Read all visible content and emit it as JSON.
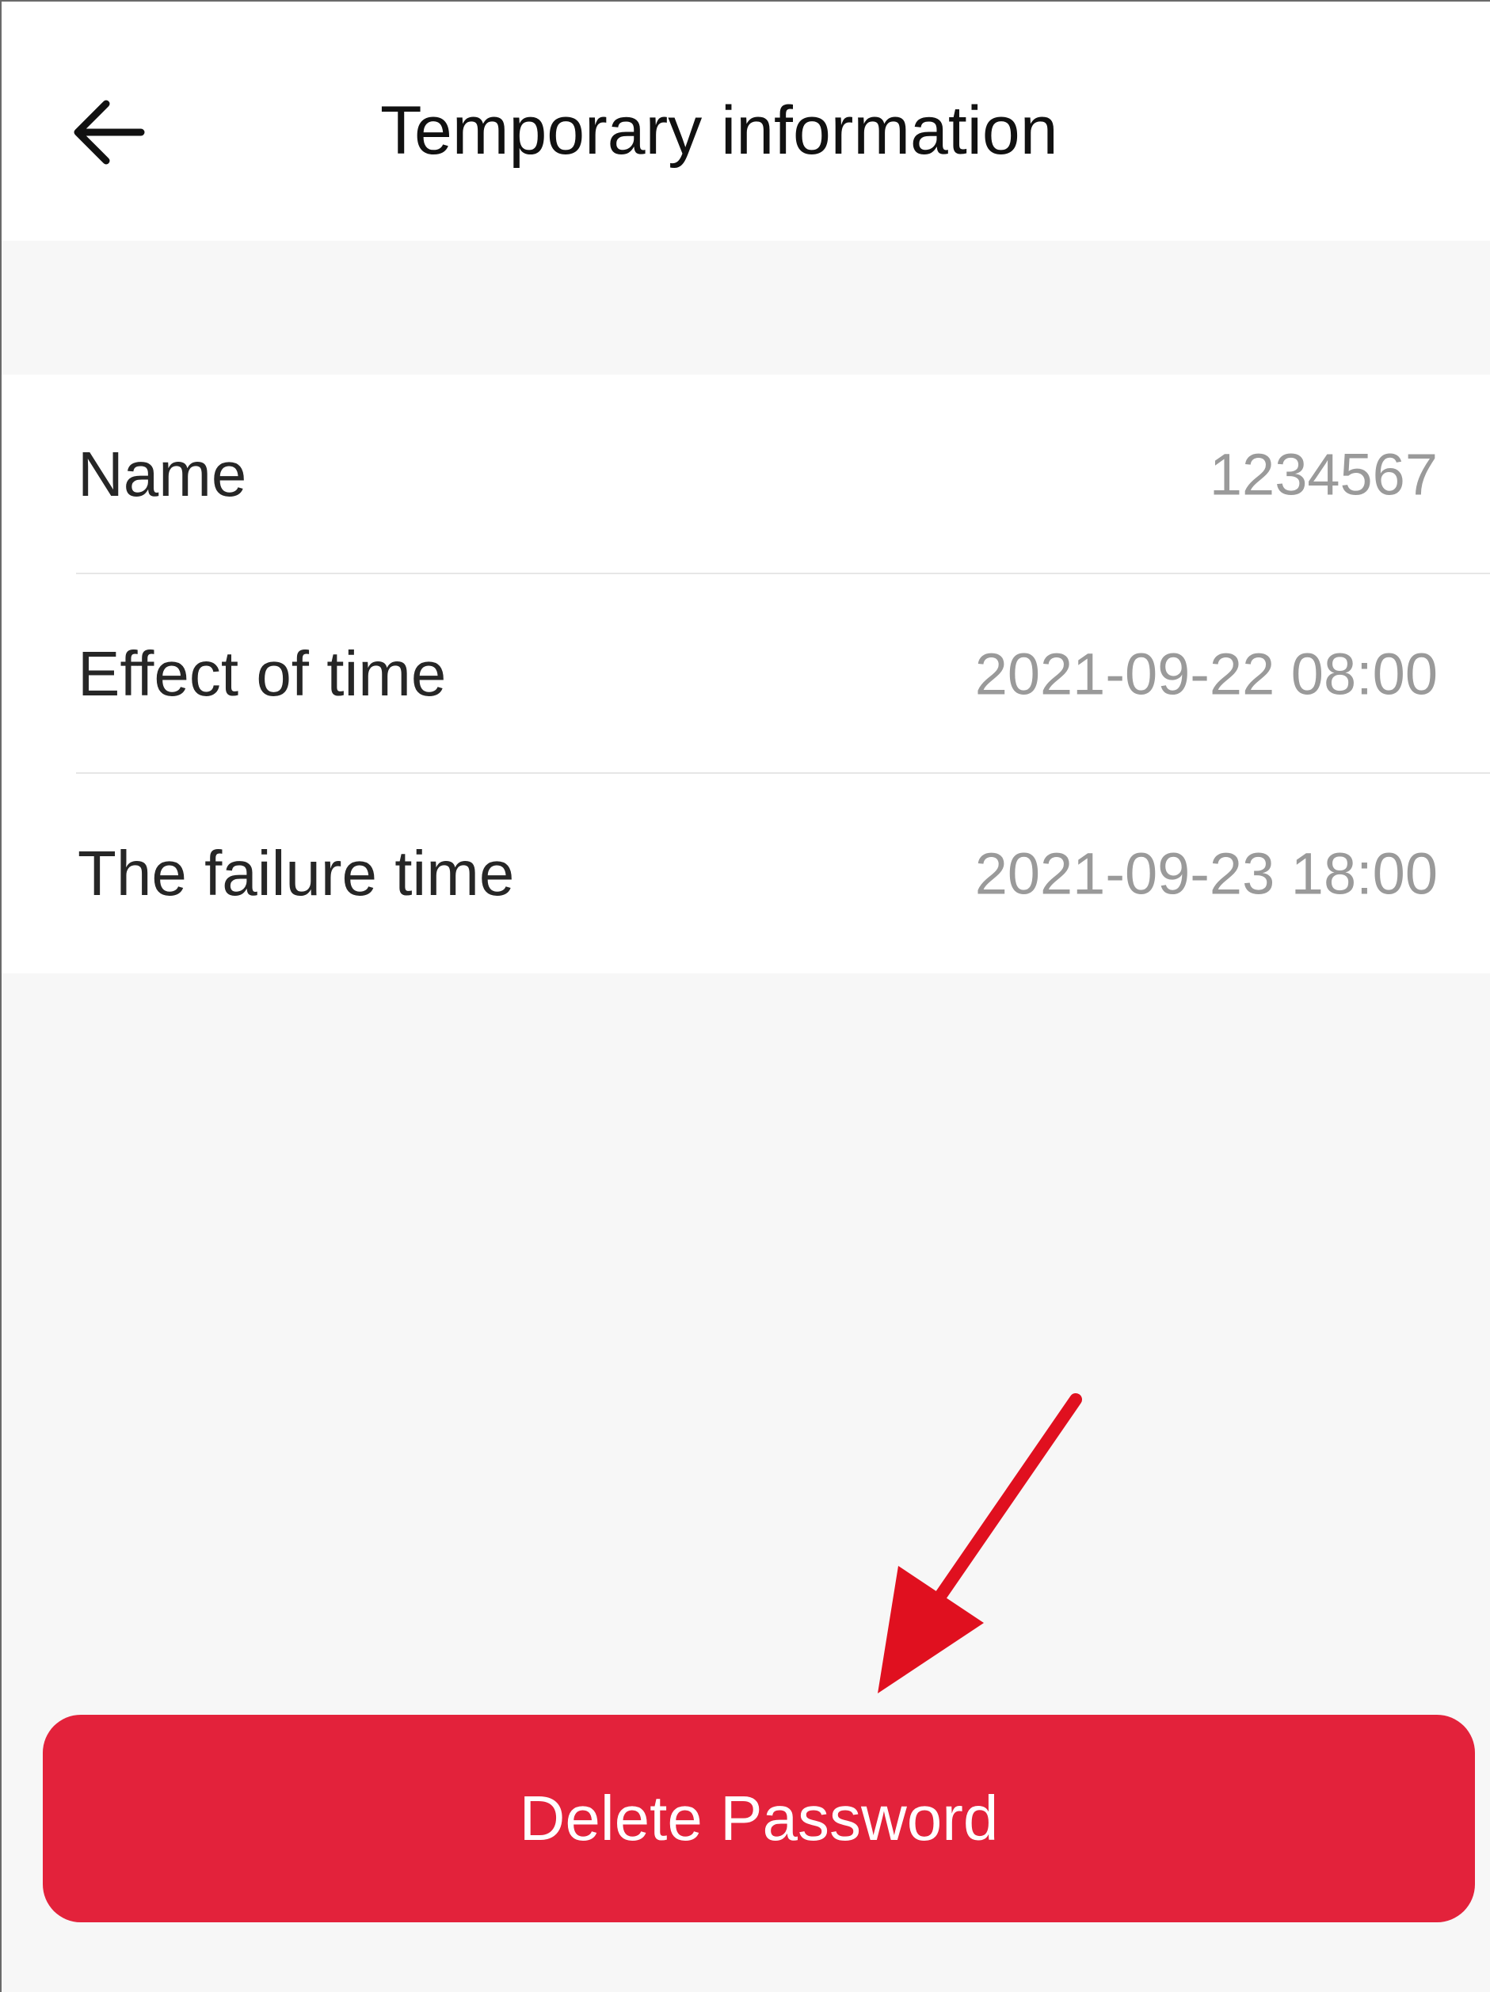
{
  "header": {
    "title": "Temporary information",
    "back_icon": "arrow-left-icon"
  },
  "info": {
    "rows": [
      {
        "label": "Name",
        "value": "1234567"
      },
      {
        "label": "Effect of time",
        "value": "2021-09-22 08:00"
      },
      {
        "label": "The failure time",
        "value": "2021-09-23 18:00"
      }
    ]
  },
  "actions": {
    "delete_label": "Delete Password"
  },
  "colors": {
    "accent": "#e3223b",
    "annotation": "#e0101f",
    "background": "#f7f7f7"
  }
}
